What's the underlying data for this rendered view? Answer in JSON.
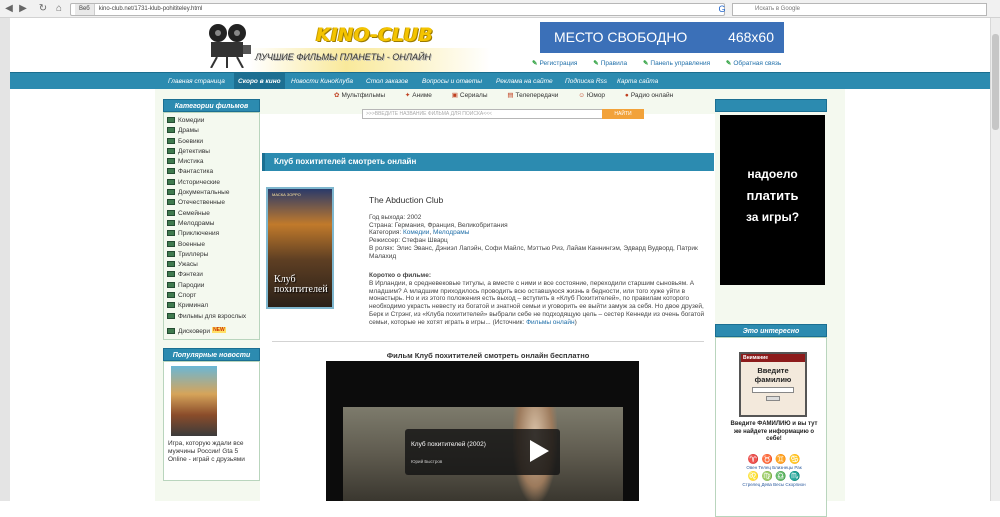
{
  "browser": {
    "address_label": "Веб",
    "url": "kino-club.net/1731-klub-pohititeley.html",
    "search_placeholder": "Искать в Google",
    "back_icon": "back-arrow-icon",
    "forward_icon": "forward-arrow-icon",
    "reload_icon": "reload-icon",
    "home_icon": "home-icon"
  },
  "header": {
    "logo_title": "KINO-CLUB",
    "logo_subtitle": "ЛУЧШИЕ ФИЛЬМЫ ПЛАНЕТЫ - ОНЛАЙН",
    "ad_text": "МЕСТО СВОБОДНО",
    "ad_size": "468x60",
    "links": [
      "Регистрация",
      "Правила",
      "Панель управления",
      "Обратная связь"
    ]
  },
  "menu": {
    "items": [
      "Главная страница",
      "Скоро в кино",
      "Новости КиноКлуба",
      "Стол заказов",
      "Вопросы и ответы",
      "Реклама на сайте",
      "Подписка Rss",
      "Карта сайта"
    ],
    "active_index": 1
  },
  "quicknav": [
    "Мультфильмы",
    "Аниме",
    "Сериалы",
    "Телепередачи",
    "Юмор",
    "Радио онлайн"
  ],
  "search": {
    "placeholder": ">>>ВВЕДИТЕ НАЗВАНИЕ ФИЛЬМА ДЛЯ ПОИСКА<<<",
    "button": "НАЙТИ"
  },
  "sidebar": {
    "categories_title": "Категории фильмов",
    "categories": [
      "Комедии",
      "Драмы",
      "Боевики",
      "Детективы",
      "Мистика",
      "Фантастика",
      "Исторические",
      "Документальные",
      "Отечественные",
      "Семейные",
      "Мелодрамы",
      "Приключения",
      "Военные",
      "Триллеры",
      "Ужасы",
      "Фэнтези",
      "Пародии",
      "Спорт",
      "Криминал",
      "Фильмы для взрослых"
    ],
    "discover_label": "Дисковери",
    "discover_tag": "NEW",
    "popular_title": "Популярные новости",
    "popular_item": "Игра, которую ждали все мужчины России! Gta 5 Online - играй с друзьями"
  },
  "movie": {
    "page_title": "Клуб похитителей смотреть онлайн",
    "original_title": "The Abduction Club",
    "year": "Год выхода: 2002",
    "country": "Страна: Германия, Франция, Великобритания",
    "category_label": "Категория:",
    "category_links": [
      "Комедии",
      "Мелодрамы"
    ],
    "director": "Режиссер: Стефан Шварц",
    "cast": "В ролях: Элис Эванс, Дэниэл Лапэйн, Софи Майлс, Мэттью Риз, Лайам Каннингэм, Эдвард Вудворд, Патрик Малахид",
    "plot_heading": "Коротко о фильме:",
    "plot": "В Ирландии, в средневековые титулы, а вместе с ними и все состояние, переходили старшим сыновьям. А младшим? А младшим приходилось проводить всю оставшуюся жизнь в бедности, или того хуже уйти в монастырь. Но и из этого положения есть выход – вступить в «Клуб Похитителей», по правилам которого необходимо украсть невесту из богатой и знатной семьи и уговорить ее выйти замуж за себя. Но двое друзей, Берк и Стрэнг, из «Клуба похитителей» выбрали себе не подходящую цель – сестер Кеннеди из очень богатой семьи, которые не хотят играть в игры...",
    "source_label": "(Источник:",
    "source_link": "Фильмы онлайн",
    "poster_title": "Клуб похитителей",
    "poster_top": "МАСКА ЗОРРО",
    "video_heading": "Фильм Клуб похитителей смотреть онлайн бесплатно",
    "player_title": "Клуб похитителей (2002)",
    "player_sub": "Юрий Быстров"
  },
  "right": {
    "ad_line1": "надоело",
    "ad_line2": "платить",
    "ad_line3": "за игры?",
    "interest_title": "Это интересно",
    "widget_header": "Внимание",
    "widget_text": "Введите фамилию",
    "promo": "Введите ФАМИЛИЮ и вы тут же найдете информацию о себе!",
    "zodiac_row1": "♈ ♉ ♊ ♋",
    "zodiac_labels1": "Овен Телец Близнецы Рак",
    "zodiac_row2": "♌ ♍ ♎ ♏",
    "zodiac_labels2": "Стрелец Дева Весы Скорпион"
  }
}
